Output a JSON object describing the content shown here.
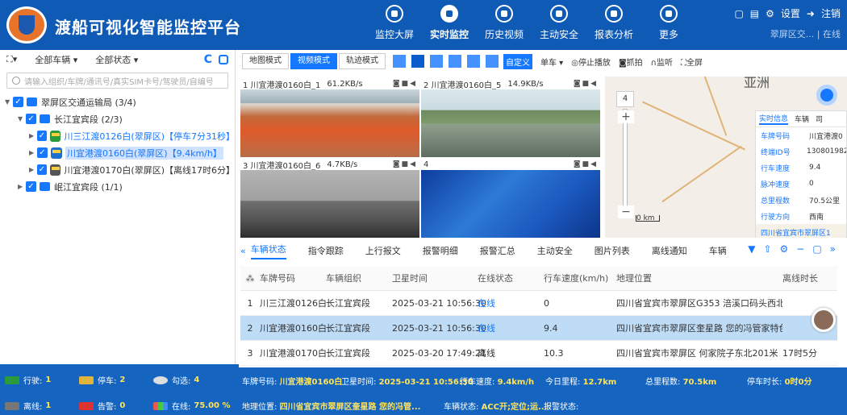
{
  "header": {
    "title": "渡船可视化智能监控平台",
    "nav": [
      {
        "label": "监控大屏",
        "icon": "home-icon"
      },
      {
        "label": "实时监控",
        "icon": "location-icon",
        "active": true
      },
      {
        "label": "历史视频",
        "icon": "camera-icon"
      },
      {
        "label": "主动安全",
        "icon": "shield-icon"
      },
      {
        "label": "报表分析",
        "icon": "chart-icon"
      },
      {
        "label": "更多",
        "icon": "chevron-down-icon"
      }
    ],
    "settings_label": "设置",
    "logout_label": "注销",
    "user": "翠屏区交...",
    "status": "在线",
    "accent": "#0f5ab5"
  },
  "left": {
    "filter_vehicles": "全部车辆",
    "filter_status": "全部状态",
    "search_placeholder": "请输入组织/车牌/通讯号/真实SIM卡号/驾驶员/自编号",
    "tree": {
      "root": "翠屏区交通运输局 (3/4)",
      "group1": "长江宜宾段 (2/3)",
      "v1": "川三江渡0126白(翠屏区)【停车7分31秒】",
      "v2": "川宜港渡0160白(翠屏区)【9.4km/h】",
      "v3": "川宜港渡0170白(翠屏区)【离线17时6分】",
      "group2": "岷江宜宾段 (1/1)"
    },
    "stats": {
      "driving_label": "行驶:",
      "driving": "1",
      "parking_label": "停车:",
      "parking": "2",
      "selected_label": "勾选:",
      "selected": "4",
      "offline_label": "离线:",
      "offline": "1",
      "alarm_label": "告警:",
      "alarm": "0",
      "online_label": "在线:",
      "online": "75.00 %"
    }
  },
  "toolbar": {
    "map_mode": "地图模式",
    "video_mode": "视频模式",
    "track_mode": "轨迹模式",
    "custom": "自定义",
    "vehicle": "单车",
    "stop": "停止播放",
    "capture": "抓拍",
    "listen": "监听",
    "fullscreen": "全屏"
  },
  "videos": [
    {
      "title": "1  川宜港渡0160白_1",
      "rate": "61.2KB/s"
    },
    {
      "title": "2  川宜港渡0160白_5",
      "rate": "14.9KB/s"
    },
    {
      "title": "3  川宜港渡0160白_6",
      "rate": "4.7KB/s"
    },
    {
      "title": "4",
      "rate": ""
    }
  ],
  "map": {
    "zoom": "4",
    "scale": "0 km",
    "place": "亚洲",
    "info_tab1": "实时信息",
    "info_tab2": "车辆",
    "info_tab3": "司",
    "fields": [
      {
        "k": "车牌号码",
        "v": "川宜港渡0"
      },
      {
        "k": "终端ID号",
        "v": "130801982"
      },
      {
        "k": "行车速度",
        "v": "9.4"
      },
      {
        "k": "脉冲速度",
        "v": "0"
      },
      {
        "k": "总里程数",
        "v": "70.5公里"
      },
      {
        "k": "行驶方向",
        "v": "西南"
      }
    ],
    "location": "四川省宜宾市翠屏区1"
  },
  "bottom_tabs": [
    "车辆状态",
    "指令跟踪",
    "上行报文",
    "报警明细",
    "报警汇总",
    "主动安全",
    "图片列表",
    "离线通知",
    "车辆"
  ],
  "table": {
    "headers": [
      "车牌号码",
      "车辆组织",
      "卫星时间",
      "在线状态",
      "行车速度(km/h)",
      "地理位置",
      "离线时长"
    ],
    "rows": [
      {
        "n": "1",
        "plate": "川三江渡0126白",
        "org": "长江宜宾段",
        "time": "2025-03-21 10:56:30",
        "status": "在线",
        "speed": "0",
        "loc": "四川省宜宾市翠屏区G353 涪溪口码头西北",
        "dur": ""
      },
      {
        "n": "2",
        "plate": "川宜港渡0160白",
        "org": "长江宜宾段",
        "time": "2025-03-21 10:56:30",
        "status": "在线",
        "speed": "9.4",
        "loc": "四川省宜宾市翠屏区奎星路 您的冯管家特色",
        "dur": ""
      },
      {
        "n": "3",
        "plate": "川宜港渡0170白",
        "org": "长江宜宾段",
        "time": "2025-03-20 17:49:21",
        "status": "离线",
        "speed": "10.3",
        "loc": "四川省宜宾市翠屏区 何家院子东北201米",
        "dur": "17时5分"
      }
    ]
  },
  "footer": {
    "plate_label": "车牌号码:",
    "plate": "川宜港渡0160白",
    "time_label": "卫星时间:",
    "time": "2025-03-21 10:56:30",
    "speed_label": "行车速度:",
    "speed": "9.4km/h",
    "today_label": "今日里程:",
    "today": "12.7km",
    "total_label": "总里程数:",
    "total": "70.5km",
    "park_label": "停车时长:",
    "park": "0时0分",
    "loc_label": "地理位置:",
    "loc": "四川省宜宾市翠屏区奎星路 您的冯管...",
    "vstatus_label": "车辆状态:",
    "vstatus": "ACC开;定位;运...",
    "alarm_label": "报警状态:",
    "alarm": ""
  }
}
